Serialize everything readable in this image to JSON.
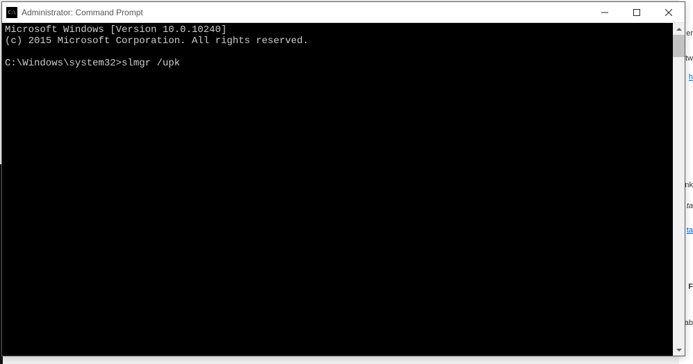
{
  "titlebar": {
    "icon_text": "C:\\",
    "title": "Administrator: Command Prompt"
  },
  "console": {
    "line1": "Microsoft Windows [Version 10.0.10240]",
    "line2": "(c) 2015 Microsoft Corporation. All rights reserved.",
    "line3": "",
    "prompt": "C:\\Windows\\system32>",
    "command": "slmgr /upk"
  },
  "bg": {
    "f1": "er",
    "f2": "tw",
    "f3": "h",
    "f4": "nk",
    "f5": "ta",
    "f6": "ta",
    "f7": "F",
    "f8": "ab"
  }
}
